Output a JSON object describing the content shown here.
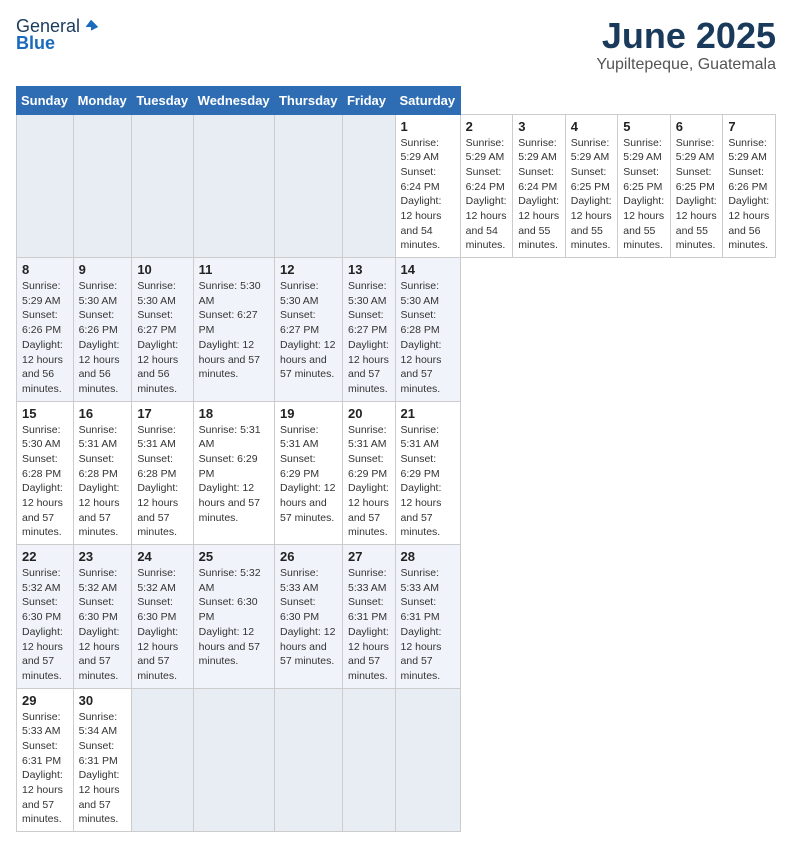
{
  "header": {
    "logo": {
      "general": "General",
      "blue": "Blue"
    },
    "title": "June 2025",
    "location": "Yupiltepeque, Guatemala"
  },
  "calendar": {
    "days_of_week": [
      "Sunday",
      "Monday",
      "Tuesday",
      "Wednesday",
      "Thursday",
      "Friday",
      "Saturday"
    ],
    "weeks": [
      [
        null,
        null,
        null,
        null,
        null,
        null,
        {
          "day": 1,
          "sunrise": "5:29 AM",
          "sunset": "6:24 PM",
          "daylight": "12 hours and 54 minutes."
        },
        {
          "day": 2,
          "sunrise": "5:29 AM",
          "sunset": "6:24 PM",
          "daylight": "12 hours and 54 minutes."
        },
        {
          "day": 3,
          "sunrise": "5:29 AM",
          "sunset": "6:24 PM",
          "daylight": "12 hours and 55 minutes."
        },
        {
          "day": 4,
          "sunrise": "5:29 AM",
          "sunset": "6:25 PM",
          "daylight": "12 hours and 55 minutes."
        },
        {
          "day": 5,
          "sunrise": "5:29 AM",
          "sunset": "6:25 PM",
          "daylight": "12 hours and 55 minutes."
        },
        {
          "day": 6,
          "sunrise": "5:29 AM",
          "sunset": "6:25 PM",
          "daylight": "12 hours and 55 minutes."
        },
        {
          "day": 7,
          "sunrise": "5:29 AM",
          "sunset": "6:26 PM",
          "daylight": "12 hours and 56 minutes."
        }
      ],
      [
        {
          "day": 8,
          "sunrise": "5:29 AM",
          "sunset": "6:26 PM",
          "daylight": "12 hours and 56 minutes."
        },
        {
          "day": 9,
          "sunrise": "5:30 AM",
          "sunset": "6:26 PM",
          "daylight": "12 hours and 56 minutes."
        },
        {
          "day": 10,
          "sunrise": "5:30 AM",
          "sunset": "6:27 PM",
          "daylight": "12 hours and 56 minutes."
        },
        {
          "day": 11,
          "sunrise": "5:30 AM",
          "sunset": "6:27 PM",
          "daylight": "12 hours and 57 minutes."
        },
        {
          "day": 12,
          "sunrise": "5:30 AM",
          "sunset": "6:27 PM",
          "daylight": "12 hours and 57 minutes."
        },
        {
          "day": 13,
          "sunrise": "5:30 AM",
          "sunset": "6:27 PM",
          "daylight": "12 hours and 57 minutes."
        },
        {
          "day": 14,
          "sunrise": "5:30 AM",
          "sunset": "6:28 PM",
          "daylight": "12 hours and 57 minutes."
        }
      ],
      [
        {
          "day": 15,
          "sunrise": "5:30 AM",
          "sunset": "6:28 PM",
          "daylight": "12 hours and 57 minutes."
        },
        {
          "day": 16,
          "sunrise": "5:31 AM",
          "sunset": "6:28 PM",
          "daylight": "12 hours and 57 minutes."
        },
        {
          "day": 17,
          "sunrise": "5:31 AM",
          "sunset": "6:28 PM",
          "daylight": "12 hours and 57 minutes."
        },
        {
          "day": 18,
          "sunrise": "5:31 AM",
          "sunset": "6:29 PM",
          "daylight": "12 hours and 57 minutes."
        },
        {
          "day": 19,
          "sunrise": "5:31 AM",
          "sunset": "6:29 PM",
          "daylight": "12 hours and 57 minutes."
        },
        {
          "day": 20,
          "sunrise": "5:31 AM",
          "sunset": "6:29 PM",
          "daylight": "12 hours and 57 minutes."
        },
        {
          "day": 21,
          "sunrise": "5:31 AM",
          "sunset": "6:29 PM",
          "daylight": "12 hours and 57 minutes."
        }
      ],
      [
        {
          "day": 22,
          "sunrise": "5:32 AM",
          "sunset": "6:30 PM",
          "daylight": "12 hours and 57 minutes."
        },
        {
          "day": 23,
          "sunrise": "5:32 AM",
          "sunset": "6:30 PM",
          "daylight": "12 hours and 57 minutes."
        },
        {
          "day": 24,
          "sunrise": "5:32 AM",
          "sunset": "6:30 PM",
          "daylight": "12 hours and 57 minutes."
        },
        {
          "day": 25,
          "sunrise": "5:32 AM",
          "sunset": "6:30 PM",
          "daylight": "12 hours and 57 minutes."
        },
        {
          "day": 26,
          "sunrise": "5:33 AM",
          "sunset": "6:30 PM",
          "daylight": "12 hours and 57 minutes."
        },
        {
          "day": 27,
          "sunrise": "5:33 AM",
          "sunset": "6:31 PM",
          "daylight": "12 hours and 57 minutes."
        },
        {
          "day": 28,
          "sunrise": "5:33 AM",
          "sunset": "6:31 PM",
          "daylight": "12 hours and 57 minutes."
        }
      ],
      [
        {
          "day": 29,
          "sunrise": "5:33 AM",
          "sunset": "6:31 PM",
          "daylight": "12 hours and 57 minutes."
        },
        {
          "day": 30,
          "sunrise": "5:34 AM",
          "sunset": "6:31 PM",
          "daylight": "12 hours and 57 minutes."
        },
        null,
        null,
        null,
        null,
        null
      ]
    ]
  }
}
